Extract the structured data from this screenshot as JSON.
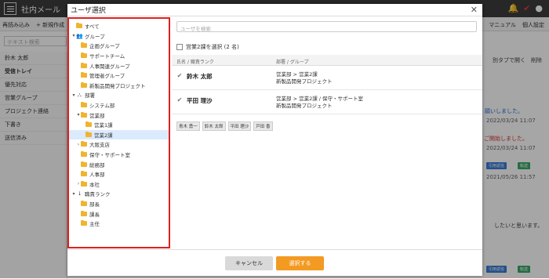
{
  "app": {
    "title": "社内メール"
  },
  "toolbar": {
    "reload": "再読み込み",
    "new": "+ 新規作成",
    "manual": "マニュアル",
    "personal": "個人設定"
  },
  "bg": {
    "search_placeholder": "テキスト検索",
    "user": "鈴木 太郎",
    "folders": [
      "受信トレイ",
      "優先対応",
      "営業グループ",
      "プロジェクト連絡",
      "下書き",
      "送信済み"
    ],
    "tab_open": "別タブで開く",
    "delete": "削除",
    "msg1": "願いしました。",
    "date1": "2022/03/24 11:07",
    "msg2": "ご開始しました。",
    "date2": "2022/03/24 11:07",
    "date3": "2021/05/26 11:57",
    "msg3": "したいと思います。",
    "btn_quote": "引用返信",
    "btn_forward": "転送"
  },
  "modal": {
    "title": "ユーザ選択",
    "close_icon": "close-icon",
    "tree": [
      {
        "label": "すべて",
        "toggle": "",
        "icon": "folder",
        "indent": 0
      },
      {
        "label": "グループ",
        "toggle": "▾",
        "icon": "group",
        "indent": 0
      },
      {
        "label": "企画グループ",
        "toggle": "",
        "icon": "folder",
        "indent": 1
      },
      {
        "label": "サポートチーム",
        "toggle": "",
        "icon": "folder",
        "indent": 1
      },
      {
        "label": "人事関連グループ",
        "toggle": "",
        "icon": "folder",
        "indent": 1
      },
      {
        "label": "管理者グループ",
        "toggle": "",
        "icon": "folder",
        "indent": 1
      },
      {
        "label": "新製品開発プロジェクト",
        "toggle": "",
        "icon": "folder",
        "indent": 1
      },
      {
        "label": "部署",
        "toggle": "▾",
        "icon": "org",
        "indent": 0
      },
      {
        "label": "システム部",
        "toggle": "",
        "icon": "folder",
        "indent": 1
      },
      {
        "label": "営業部",
        "toggle": "▾",
        "icon": "folder",
        "indent": 1
      },
      {
        "label": "営業1課",
        "toggle": "",
        "icon": "folder",
        "indent": 2
      },
      {
        "label": "営業2課",
        "toggle": "",
        "icon": "folder",
        "indent": 2,
        "selected": true
      },
      {
        "label": "大阪支店",
        "toggle": "›",
        "icon": "folder",
        "indent": 1
      },
      {
        "label": "保守・サポート室",
        "toggle": "",
        "icon": "folder",
        "indent": 1
      },
      {
        "label": "総務部",
        "toggle": "",
        "icon": "folder",
        "indent": 1
      },
      {
        "label": "人事部",
        "toggle": "",
        "icon": "folder",
        "indent": 1
      },
      {
        "label": "本社",
        "toggle": "›",
        "icon": "folder",
        "indent": 1
      },
      {
        "label": "職責ランク",
        "toggle": "▾",
        "icon": "rank",
        "indent": 0
      },
      {
        "label": "部長",
        "toggle": "",
        "icon": "folder",
        "indent": 1
      },
      {
        "label": "課長",
        "toggle": "",
        "icon": "folder",
        "indent": 1
      },
      {
        "label": "主任",
        "toggle": "",
        "icon": "folder",
        "indent": 1
      }
    ],
    "search_placeholder": "ユーザを検索",
    "select_all_label": "営業2課を選択 (2 名)",
    "col_name": "氏名 / 職責ランク",
    "col_group": "部署 / グループ",
    "users": [
      {
        "name": "鈴木 太郎",
        "dept": "営業部 > 営業2課",
        "group": "新製品開発プロジェクト"
      },
      {
        "name": "平田 理沙",
        "dept": "営業部 > 営業2課 / 保守・サポート室",
        "group": "新製品開発プロジェクト"
      }
    ],
    "chips": [
      "青木 勇一",
      "鈴木 太郎",
      "平田 理沙",
      "戸田 香"
    ],
    "cancel_label": "キャンセル",
    "select_label": "選択する"
  },
  "colors": {
    "accent": "#f39a23",
    "highlight": "#e0201f",
    "selected_row": "#dbeafd"
  }
}
